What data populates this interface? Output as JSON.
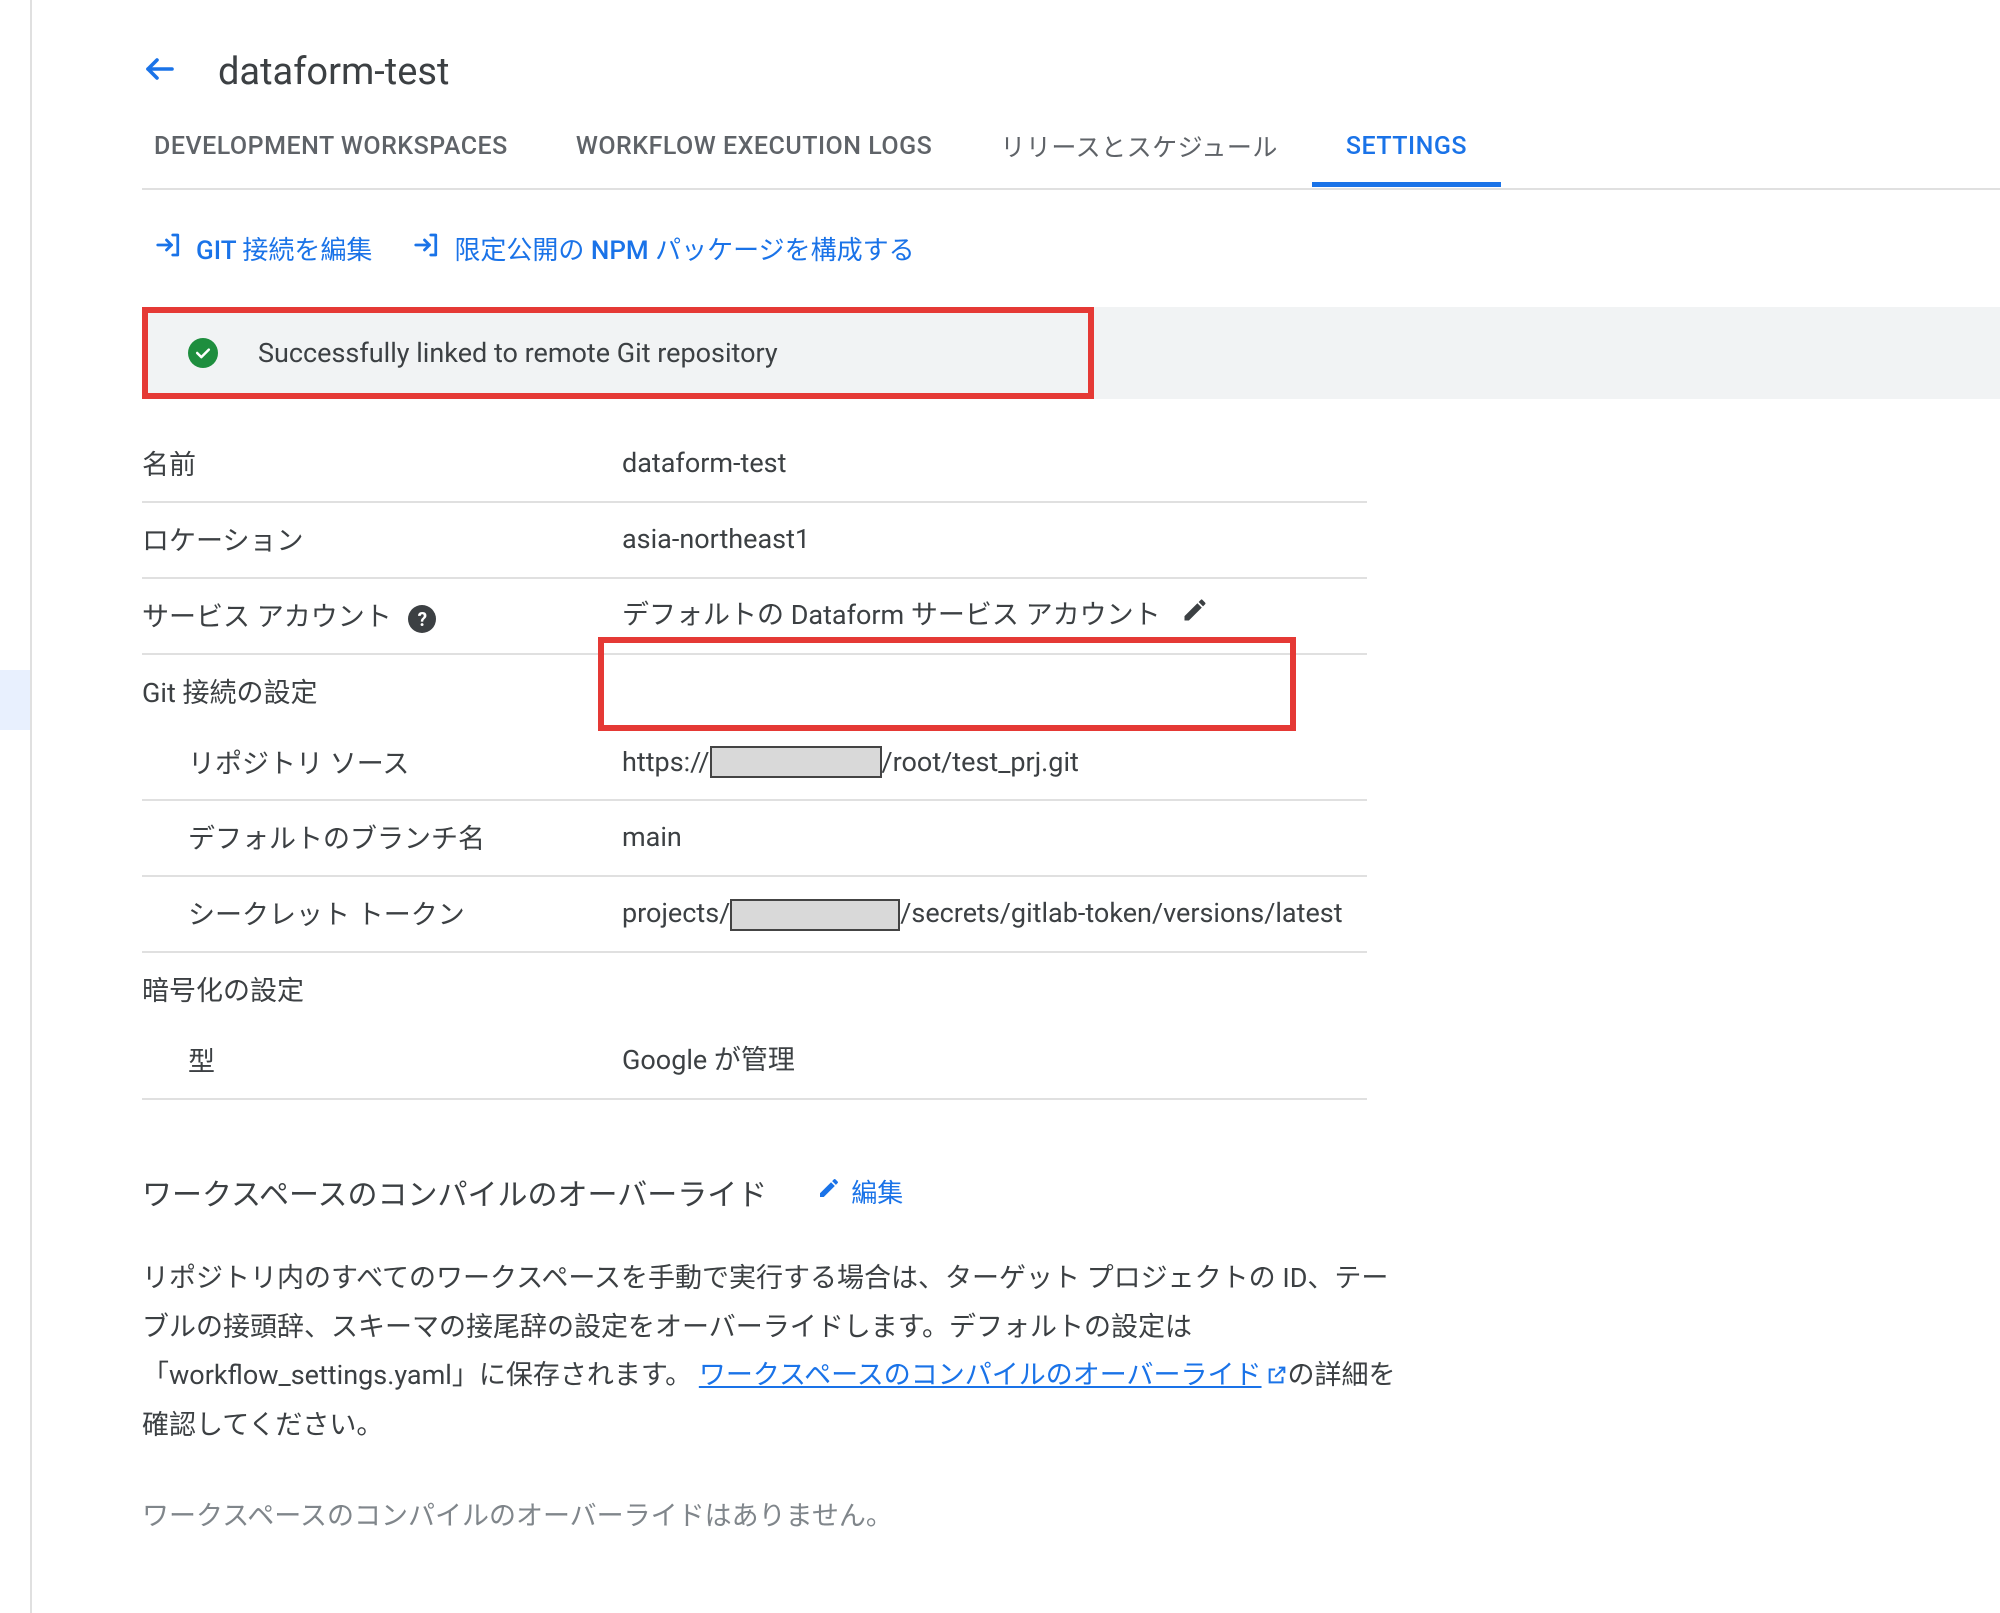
{
  "header": {
    "title": "dataform-test"
  },
  "tabs": [
    {
      "label": "DEVELOPMENT WORKSPACES",
      "active": false
    },
    {
      "label": "WORKFLOW EXECUTION LOGS",
      "active": false
    },
    {
      "label": "リリースとスケジュール",
      "active": false
    },
    {
      "label": "SETTINGS",
      "active": true
    }
  ],
  "actions": {
    "edit_git": "GIT 接続を編集",
    "configure_npm": "限定公開の NPM パッケージを構成する"
  },
  "banner": {
    "message": "Successfully linked to remote Git repository"
  },
  "settings": {
    "name_label": "名前",
    "name_value": "dataform-test",
    "location_label": "ロケーション",
    "location_value": "asia-northeast1",
    "sa_label": "サービス アカウント",
    "sa_value": "デフォルトの Dataform サービス アカウント",
    "git_section": "Git 接続の設定",
    "repo_label": "リポジトリ ソース",
    "repo_prefix": "https://",
    "repo_suffix": "/root/test_prj.git",
    "branch_label": "デフォルトのブランチ名",
    "branch_value": "main",
    "secret_label": "シークレット トークン",
    "secret_prefix": "projects/",
    "secret_suffix": "/secrets/gitlab-token/versions/latest",
    "enc_section": "暗号化の設定",
    "enc_type_label": "型",
    "enc_type_value": "Google が管理"
  },
  "overrides": {
    "title": "ワークスペースのコンパイルのオーバーライド",
    "edit_label": "編集",
    "desc_part1": "リポジトリ内のすべてのワークスペースを手動で実行する場合は、ターゲット プロジェクトの ID、テーブルの接頭辞、スキーマの接尾辞の設定をオーバーライドします。デフォルトの設定は「workflow_settings.yaml」に保存されます。",
    "link_text": "ワークスペースのコンパイルのオーバーライド",
    "desc_part2": "の詳細を確認してください。",
    "empty": "ワークスペースのコンパイルのオーバーライドはありません。"
  }
}
